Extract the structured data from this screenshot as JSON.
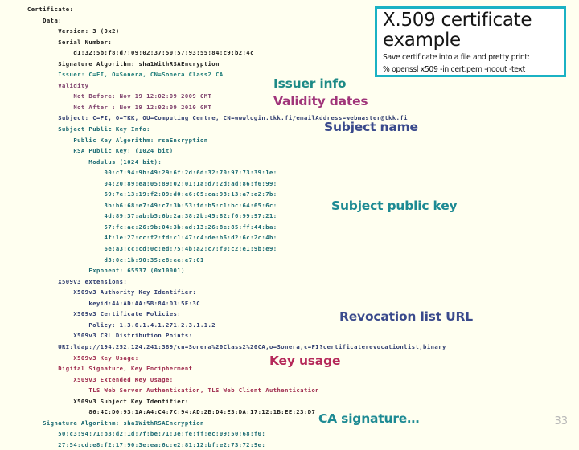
{
  "slide": {
    "background_color": "#FFFFF0",
    "page_number": "33"
  },
  "title_card": {
    "border_color": "#1BB2C4",
    "heading_line1": "X.509 certificate",
    "heading_line2": "example",
    "sub_line1": "Save certificate into a file and pretty print:",
    "sub_line2": "% openssl x509 -in cert.pem -noout -text"
  },
  "callouts": {
    "issuer": {
      "label": "Issuer info",
      "color": "#1D8A86"
    },
    "validity": {
      "label": "Validity dates",
      "color": "#A0357A"
    },
    "subject": {
      "label": "Subject name",
      "color": "#3A4A8C"
    },
    "pubkey": {
      "label": "Subject public key",
      "color": "#1D8A93"
    },
    "crl": {
      "label": "Revocation list URL",
      "color": "#3A4A8C"
    },
    "keyusage": {
      "label": "Key usage",
      "color": "#B5295A"
    },
    "casig": {
      "label": "CA signature…",
      "color": "#1D8A93"
    }
  },
  "cert_dump": {
    "lines": [
      {
        "text": "Certificate:",
        "color": "black"
      },
      {
        "text": "    Data:",
        "color": "black"
      },
      {
        "text": "        Version: 3 (0x2)",
        "color": "black"
      },
      {
        "text": "        Serial Number:",
        "color": "black"
      },
      {
        "text": "            d1:32:5b:f8:d7:09:02:37:50:57:93:55:84:c9:b2:4c",
        "color": "black"
      },
      {
        "text": "        Signature Algorithm: sha1WithRSAEncryption",
        "color": "black"
      },
      {
        "text": "        Issuer: C=FI, O=Sonera, CN=Sonera Class2 CA",
        "color": "teal"
      },
      {
        "text": "        Validity",
        "color": "purple"
      },
      {
        "text": "            Not Before: Nov 19 12:02:09 2009 GMT",
        "color": "purple"
      },
      {
        "text": "            Not After : Nov 19 12:02:09 2010 GMT",
        "color": "purple"
      },
      {
        "text": "        Subject: C=FI, O=TKK, OU=Computing Centre, CN=wwwlogin.tkk.fi/emailAddress=webmaster@tkk.fi",
        "color": "navy"
      },
      {
        "text": "        Subject Public Key Info:",
        "color": "dteal"
      },
      {
        "text": "            Public Key Algorithm: rsaEncryption",
        "color": "dteal"
      },
      {
        "text": "            RSA Public Key: (1024 bit)",
        "color": "dteal"
      },
      {
        "text": "                Modulus (1024 bit):",
        "color": "dteal"
      },
      {
        "text": "                    00:c7:94:9b:49:29:6f:2d:6d:32:70:97:73:39:1e:",
        "color": "dteal"
      },
      {
        "text": "                    04:20:89:ea:05:89:02:01:1a:d7:2d:ad:86:f6:99:",
        "color": "dteal"
      },
      {
        "text": "                    69:7e:13:19:f2:09:d0:e6:05:ca:93:13:a7:e2:7b:",
        "color": "dteal"
      },
      {
        "text": "                    3b:b6:68:e7:49:c7:3b:53:fd:b5:c1:bc:64:65:6c:",
        "color": "dteal"
      },
      {
        "text": "                    4d:89:37:ab:b5:6b:2a:38:2b:45:82:f6:99:97:21:",
        "color": "dteal"
      },
      {
        "text": "                    57:fc:ac:26:9b:04:3b:ad:13:26:8e:85:ff:44:ba:",
        "color": "dteal"
      },
      {
        "text": "                    4f:1e:27:cc:f2:fd:c1:47:c4:de:b6:d2:6c:2c:4b:",
        "color": "dteal"
      },
      {
        "text": "                    6e:a3:cc:cd:0c:ed:75:4b:a2:c7:f0:c2:e1:9b:e9:",
        "color": "dteal"
      },
      {
        "text": "                    d3:0c:1b:90:35:c8:ee:e7:01",
        "color": "dteal"
      },
      {
        "text": "                Exponent: 65537 (0x10001)",
        "color": "dteal"
      },
      {
        "text": "        X509v3 extensions:",
        "color": "navy"
      },
      {
        "text": "            X509v3 Authority Key Identifier:",
        "color": "navy"
      },
      {
        "text": "                keyid:4A:AD:AA:5B:84:D3:5E:3C",
        "color": "navy"
      },
      {
        "text": "            X509v3 Certificate Policies:",
        "color": "navy"
      },
      {
        "text": "                Policy: 1.3.6.1.4.1.271.2.3.1.1.2",
        "color": "navy"
      },
      {
        "text": "            X509v3 CRL Distribution Points:",
        "color": "navy"
      },
      {
        "text": "        URI:ldap://194.252.124.241:389/cn=Sonera%20Class2%20CA,o=Sonera,c=FI?certificaterevocationlist,binary",
        "color": "navy"
      },
      {
        "text": "            X509v3 Key Usage:",
        "color": "crim"
      },
      {
        "text": "        Digital Signature, Key Encipherment",
        "color": "crim"
      },
      {
        "text": "            X509v3 Extended Key Usage:",
        "color": "crim"
      },
      {
        "text": "                TLS Web Server Authentication, TLS Web Client Authentication",
        "color": "crim"
      },
      {
        "text": "            X509v3 Subject Key Identifier:",
        "color": "black"
      },
      {
        "text": "                86:4C:D0:93:1A:A4:C4:7C:94:AD:2B:D4:E3:DA:17:12:1B:EE:23:D7",
        "color": "black"
      },
      {
        "text": "    Signature Algorithm: sha1WithRSAEncryption",
        "color": "dteal"
      },
      {
        "text": "        50:c3:94:71:b3:d2:1d:7f:be:71:3e:fe:ff:ec:09:50:68:f0:",
        "color": "dteal"
      },
      {
        "text": "        27:54:cd:e8:f2:17:90:3e:ea:6c:e2:81:12:bf:e2:73:72:9e:",
        "color": "dteal"
      }
    ]
  }
}
